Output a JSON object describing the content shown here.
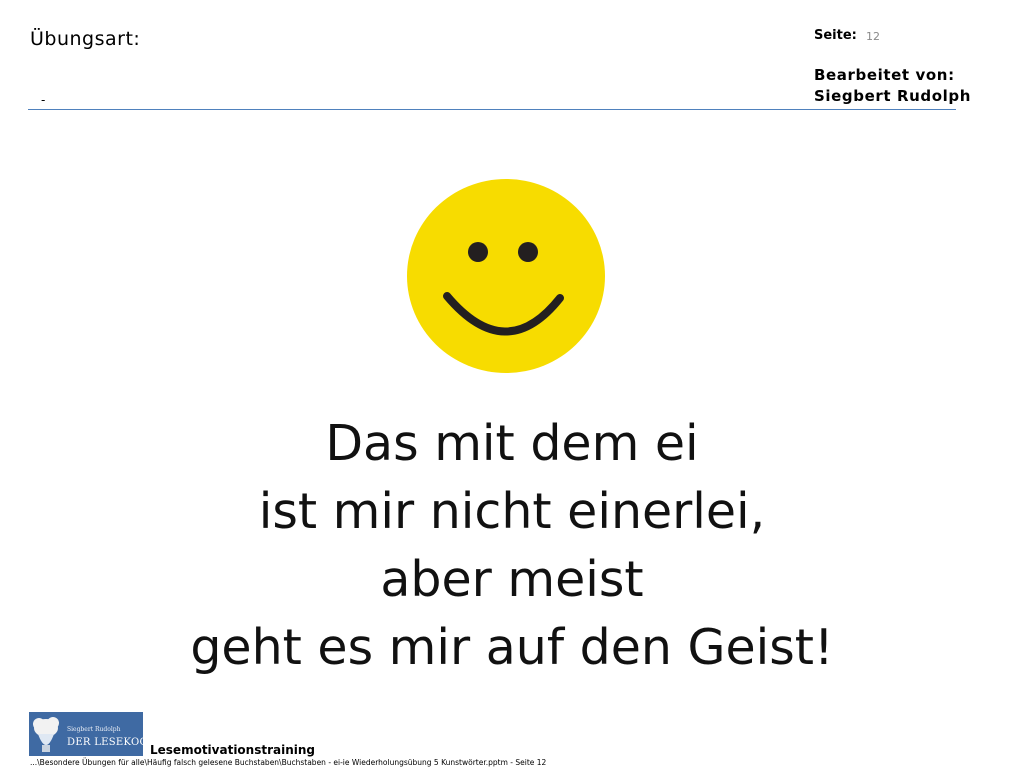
{
  "header": {
    "exercise_label": "Übungsart:",
    "exercise_value": "-",
    "page_label": "Seite:",
    "page_number": "12",
    "editor_label": "Bearbeitet von:",
    "editor_name": "Siegbert Rudolph"
  },
  "illustration": {
    "icon": "smiley-face-icon",
    "face_color": "#f7dc00",
    "feature_color": "#231f20"
  },
  "poem": {
    "lines": [
      "Das mit dem ei",
      "ist mir nicht einerlei,",
      "aber meist",
      "geht es mir auf den Geist!"
    ]
  },
  "footer": {
    "logo": {
      "line_small": "Siegbert Rudolph",
      "line_large": "DER LESEKOCH",
      "background_color": "#3f6aa3"
    },
    "program_name": "Lesemotivationstraining",
    "file_path": "...\\Besondere Übungen für alle\\Häufig falsch gelesene Buchstaben\\Buchstaben - ei-ie Wiederholungsübung 5 Kunstwörter.pptm - Seite 12"
  },
  "colors": {
    "rule": "#4f81bd",
    "page_number": "#8a8a8a"
  }
}
